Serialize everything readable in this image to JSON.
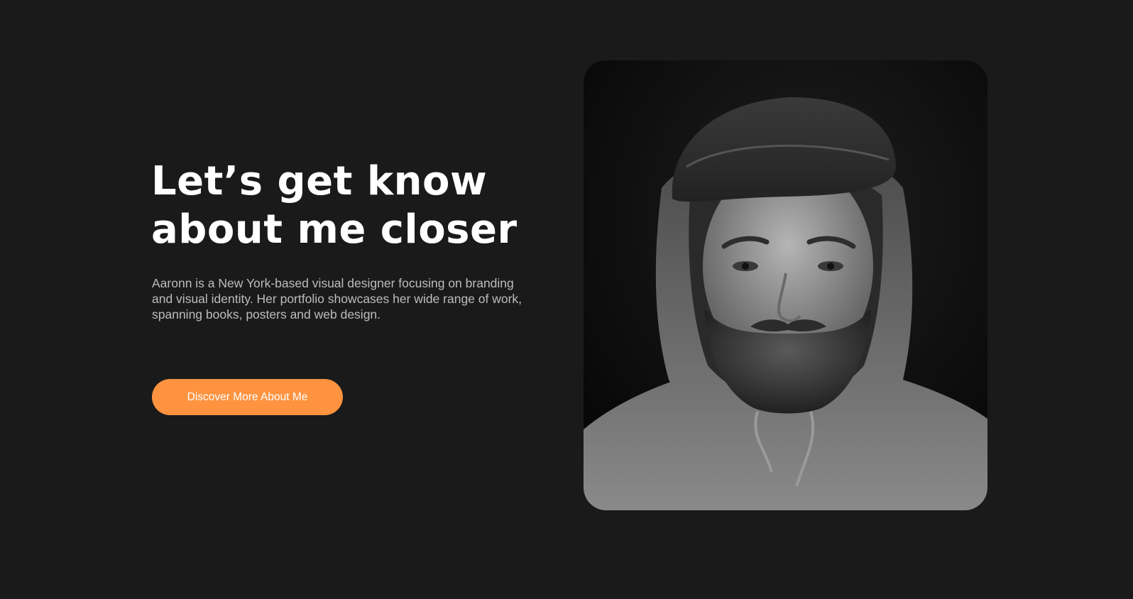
{
  "hero": {
    "heading_line1": "Let’s get know",
    "heading_line2": "about me closer",
    "description": "Aaronn is a New York-based visual designer focusing on branding and visual identity. Her portfolio showcases her wide range of work, spanning books, posters and web design.",
    "cta_label": "Discover More About Me"
  },
  "colors": {
    "background": "#1a1a1a",
    "accent": "#ff9340",
    "heading": "#ffffff",
    "body_text": "#bdbdbd"
  }
}
